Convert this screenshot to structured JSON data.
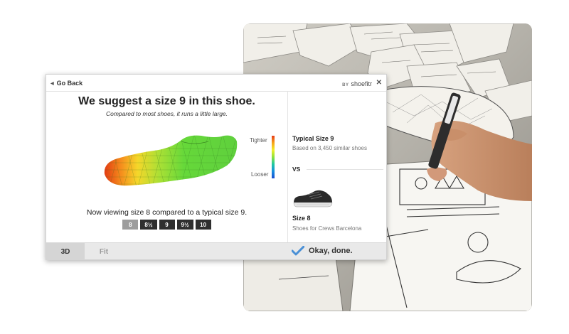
{
  "header": {
    "back_label": "Go Back",
    "brand_by": "BY",
    "brand_name": "shoefitr",
    "close_glyph": "✕"
  },
  "main": {
    "headline": "We suggest a size 9 in this shoe.",
    "subline": "Compared to most shoes, it runs a little large.",
    "scale_top": "Tighter",
    "scale_bottom": "Looser",
    "viewing": "Now viewing size 8 compared to a typical size 9.",
    "sizes": [
      "8",
      "8½",
      "9",
      "9½",
      "10"
    ],
    "active_size_index": 0
  },
  "sidebar": {
    "typical_title": "Typical Size 9",
    "typical_sub": "Based on 3,450 similar shoes",
    "vs": "VS",
    "size_title": "Size 8",
    "size_sub": "Shoes for Crews Barcelona"
  },
  "footer": {
    "tab_3d": "3D",
    "tab_fit": "Fit",
    "okay": "Okay, done."
  },
  "colors": {
    "accent_check": "#4a90d6",
    "fit_tight": "#e53b1a",
    "fit_loose": "#1a4fd0",
    "fit_neutral": "#6fd63a"
  },
  "icons": [
    "back-triangle-icon",
    "close-icon",
    "checkmark-icon",
    "sneaker-thumbnail",
    "shoe-heatmap-3d"
  ]
}
